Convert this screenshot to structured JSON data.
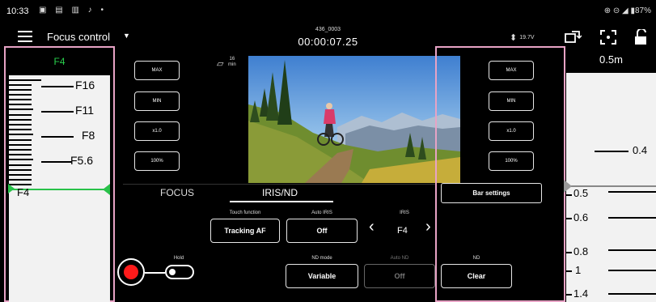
{
  "status_bar": {
    "time": "10:33",
    "left_icons": "▣ ▤ ▥ ♪ •",
    "right_text": "⊕ ⊝ ◢ ▮87%"
  },
  "header": {
    "menu_icon": "hamburger-icon",
    "mode": "Focus control",
    "clip_name": "436_0003",
    "timecode": "00:00:07.25",
    "battery_voltage": "19.7V"
  },
  "left_bar": {
    "current": "F4",
    "labels": [
      "F16",
      "F11",
      "F8",
      "F5.6",
      "F4"
    ]
  },
  "left_buttons": [
    "MAX",
    "MIN",
    "x1.0",
    "100%"
  ],
  "right_buttons": [
    "MAX",
    "MIN",
    "x1.0",
    "100%"
  ],
  "media": {
    "remaining_value": "16",
    "remaining_unit": "min"
  },
  "bar_settings": "Bar settings",
  "tabs": [
    "FOCUS",
    "IRIS/ND"
  ],
  "controls": {
    "touch_function": {
      "label": "Touch function",
      "value": "Tracking AF"
    },
    "auto_iris": {
      "label": "Auto IRIS",
      "value": "Off"
    },
    "iris": {
      "label": "IRIS",
      "value": "F4"
    },
    "nd_mode": {
      "label": "ND mode",
      "value": "Variable"
    },
    "auto_nd": {
      "label": "Auto ND",
      "value": "Off"
    },
    "nd": {
      "label": "ND",
      "value": "Clear"
    },
    "hold": {
      "label": "Hold"
    }
  },
  "focus_scale": {
    "title": "0.5m",
    "labels": [
      "0.4",
      "0.5",
      "0.6",
      "0.8",
      "1",
      "1.4"
    ]
  },
  "colors": {
    "panel_border": "#e7a3c5",
    "accent_green": "#29d04c",
    "record_red": "#ff1a1a"
  }
}
